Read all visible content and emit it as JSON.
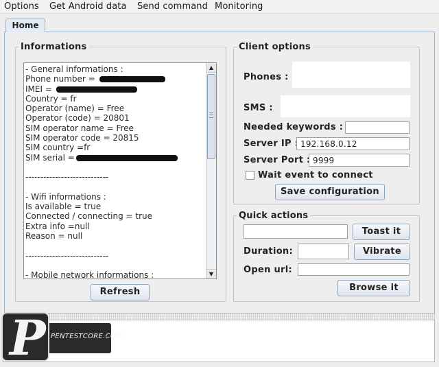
{
  "menubar": {
    "items": [
      "Options",
      "Get Android data",
      "Send command",
      "Monitoring"
    ]
  },
  "tabs": {
    "home": "Home"
  },
  "informations": {
    "title": "Informations",
    "lines": [
      " - General informations :",
      "Phone number = ",
      "IMEI = ",
      "Country = fr",
      "Operator (name) = Free",
      "Operator (code) = 20801",
      "SIM operator name = Free",
      "SIM operator code = 20815",
      "SIM country =fr",
      "SIM serial =",
      "",
      " ----------------------------",
      "",
      " - Wifi informations :",
      "Is available = true",
      "Connected / connecting = true",
      "Extra info =null",
      "Reason = null",
      "",
      " ----------------------------",
      "",
      " - Mobile network informations :"
    ],
    "refresh_label": "Refresh"
  },
  "client_options": {
    "title": "Client options",
    "phones_label": "Phones :",
    "sms_label": "SMS :",
    "keywords_label": "Needed keywords :",
    "keywords_value": "",
    "server_ip_label": "Server IP :",
    "server_ip_value": "192.168.0.12",
    "server_port_label": "Server Port :",
    "server_port_value": "9999",
    "wait_event_label": "Wait event to connect",
    "save_label": "Save configuration"
  },
  "quick_actions": {
    "title": "Quick actions",
    "toast_value": "",
    "toast_label": "Toast it",
    "duration_label": "Duration:",
    "duration_value": "",
    "vibrate_label": "Vibrate",
    "open_url_label": "Open url:",
    "url_value": "",
    "browse_label": "Browse it"
  },
  "watermark": {
    "letter": "P",
    "text": "PENTESTCORE.COM"
  }
}
